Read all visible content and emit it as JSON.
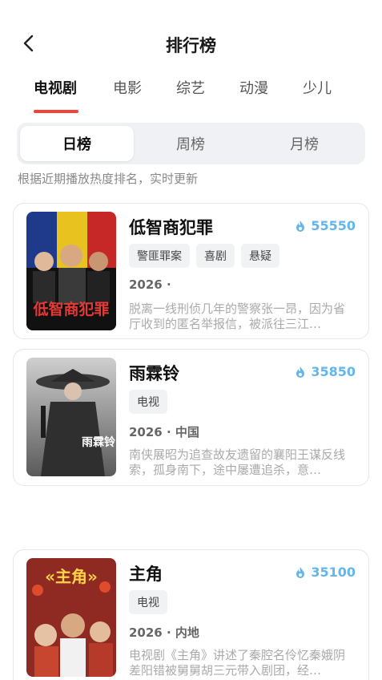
{
  "header": {
    "title": "排行榜"
  },
  "tabs": [
    {
      "label": "电视剧",
      "active": true
    },
    {
      "label": "电影",
      "active": false
    },
    {
      "label": "综艺",
      "active": false
    },
    {
      "label": "动漫",
      "active": false
    },
    {
      "label": "少儿",
      "active": false
    }
  ],
  "segments": [
    {
      "label": "日榜",
      "active": true
    },
    {
      "label": "周榜",
      "active": false
    },
    {
      "label": "月榜",
      "active": false
    }
  ],
  "hint": "根据近期播放热度排名，实时更新",
  "accent_color": "#f0433a",
  "heat_color": "#62b6ee",
  "items": [
    {
      "title": "低智商犯罪",
      "heat": "55550",
      "tags": [
        "警匪罪案",
        "喜剧",
        "悬疑"
      ],
      "meta": "2026 ·",
      "desc": "脱离一线刑侦几年的警察张一昂，因为省厅收到的匿名举报信，被派往三江…",
      "poster_text": "低智商犯罪"
    },
    {
      "title": "雨霖铃",
      "heat": "35850",
      "tags": [
        "电视"
      ],
      "meta": "2026 · 中国",
      "desc": "南侠展昭为追查故友遗留的襄阳王谋反线索，孤身南下，途中屡遭追杀，意…",
      "poster_text": "雨霖铃"
    },
    {
      "title": "主角",
      "heat": "35100",
      "tags": [
        "电视"
      ],
      "meta": "2026 · 内地",
      "desc": "电视剧《主角》讲述了秦腔名伶忆秦娥阴差阳错被舅舅胡三元带入剧团，经…",
      "poster_text": "«主角»"
    }
  ]
}
